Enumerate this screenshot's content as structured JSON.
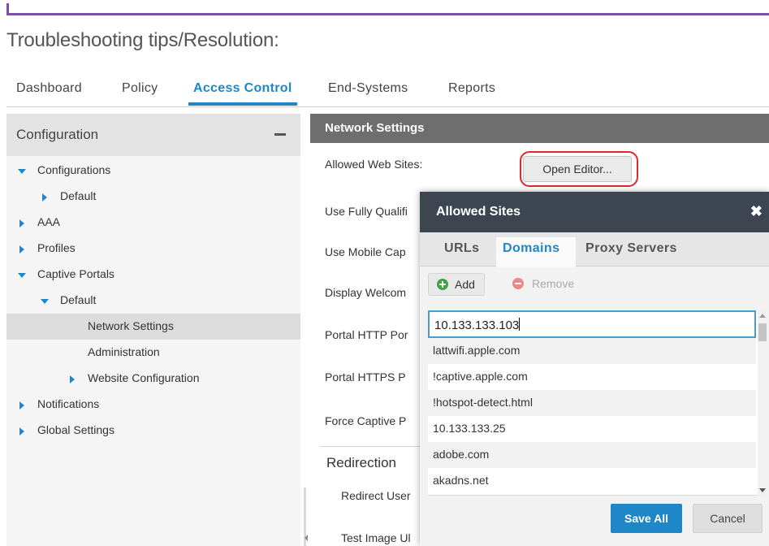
{
  "doc": {
    "heading": "Troubleshooting tips/Resolution:"
  },
  "nav": {
    "tabs": [
      "Dashboard",
      "Policy",
      "Access Control",
      "End-Systems",
      "Reports"
    ],
    "active": "Access Control"
  },
  "config": {
    "title": "Configuration",
    "tree": [
      {
        "label": "Configurations",
        "expander": "down"
      },
      {
        "label": "Default",
        "expander": "right"
      },
      {
        "label": "AAA",
        "expander": "right"
      },
      {
        "label": "Profiles",
        "expander": "right"
      },
      {
        "label": "Captive Portals",
        "expander": "down"
      },
      {
        "label": "Default",
        "expander": "down"
      },
      {
        "label": "Network Settings",
        "expander": "none",
        "selected": true
      },
      {
        "label": "Administration",
        "expander": "none"
      },
      {
        "label": "Website Configuration",
        "expander": "right"
      },
      {
        "label": "Notifications",
        "expander": "right"
      },
      {
        "label": "Global Settings",
        "expander": "right"
      }
    ]
  },
  "network_settings": {
    "title": "Network Settings",
    "allowed_sites_label": "Allowed Web Sites:",
    "open_editor_label": "Open Editor...",
    "fields": [
      "Use Fully Qualifi",
      "Use Mobile Cap",
      "Display Welcom",
      "Portal HTTP Por",
      "Portal HTTPS P",
      "Force Captive P"
    ],
    "redirection_section": "Redirection",
    "redirection_fields": [
      "Redirect User",
      "Test Image Ul"
    ]
  },
  "dialog": {
    "title": "Allowed Sites",
    "close_glyph": "✖",
    "tabs": [
      "URLs",
      "Domains",
      "Proxy Servers"
    ],
    "active_tab": "Domains",
    "add_label": "Add",
    "remove_label": "Remove",
    "editing_value": "10.133.133.103",
    "domains": [
      "lattwifi.apple.com",
      "!captive.apple.com",
      "!hotspot-detect.html",
      "10.133.133.25",
      "adobe.com",
      "akadns.net"
    ],
    "save_label": "Save All",
    "cancel_label": "Cancel"
  },
  "colors": {
    "accent": "#1f86c8",
    "dialog_header": "#3d4551",
    "panel_header": "#6e6e6e",
    "highlight": "#e0282d",
    "rule": "#7b4fa6"
  }
}
